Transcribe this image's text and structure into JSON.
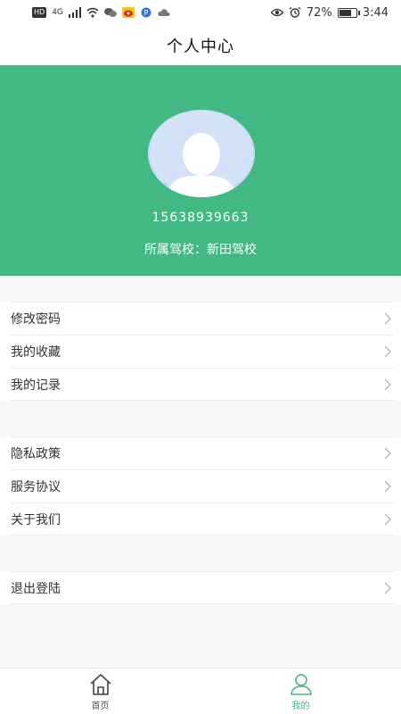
{
  "status_bar": {
    "badge": "HD",
    "network": "4G",
    "battery": "72%",
    "time": "3:44"
  },
  "nav": {
    "title": "个人中心"
  },
  "profile": {
    "phone": "15638939663",
    "school": "所属驾校：新田驾校"
  },
  "menu": {
    "group1": [
      {
        "label": "修改密码"
      },
      {
        "label": "我的收藏"
      },
      {
        "label": "我的记录"
      }
    ],
    "group2": [
      {
        "label": "隐私政策"
      },
      {
        "label": "服务协议"
      },
      {
        "label": "关于我们"
      }
    ],
    "group3": [
      {
        "label": "退出登陆"
      }
    ]
  },
  "tabs": [
    {
      "label": "首页",
      "icon": "home-icon",
      "active": false
    },
    {
      "label": "我的",
      "icon": "user-icon",
      "active": true
    }
  ],
  "colors": {
    "accent": "#42b883",
    "background": "#f7f9f9"
  }
}
